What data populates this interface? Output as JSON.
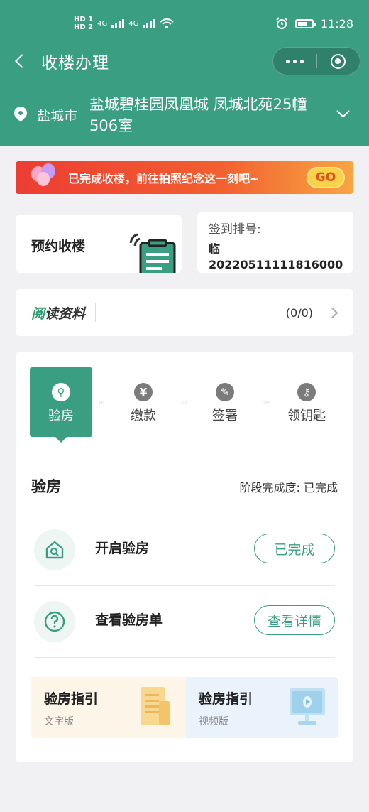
{
  "status_bar": {
    "hd1": "HD 1",
    "hd2": "HD 2",
    "network": "4G",
    "time": "11:28"
  },
  "nav": {
    "title": "收楼办理"
  },
  "location": {
    "city": "盐城市",
    "address": "盐城碧桂园凤凰城 凤城北苑25幢506室"
  },
  "banner": {
    "text": "已完成收楼，前往拍照纪念这一刻吧~",
    "button": "GO"
  },
  "appointment": {
    "label": "预约收楼"
  },
  "sign_in": {
    "label": "签到排号:",
    "value_line1": "临",
    "value_line2": "20220511111816000"
  },
  "reading": {
    "title_prefix": "阅",
    "title_rest": "读资料",
    "count": "(0/0)"
  },
  "steps": [
    {
      "label": "验房",
      "icon": "search-icon",
      "glyph": "⚲"
    },
    {
      "label": "缴款",
      "icon": "yuan-icon",
      "glyph": "¥"
    },
    {
      "label": "签署",
      "icon": "pen-icon",
      "glyph": "✎"
    },
    {
      "label": "领钥匙",
      "icon": "key-icon",
      "glyph": "⚷"
    }
  ],
  "stage": {
    "title": "验房",
    "progress": "阶段完成度:  已完成"
  },
  "tasks": [
    {
      "name": "开启验房",
      "button": "已完成",
      "icon": "house-search-icon"
    },
    {
      "name": "查看验房单",
      "button": "查看详情",
      "icon": "question-icon"
    }
  ],
  "guides": [
    {
      "title": "验房指引",
      "subtitle": "文字版",
      "icon": "document-icon"
    },
    {
      "title": "验房指引",
      "subtitle": "视频版",
      "icon": "monitor-icon"
    }
  ],
  "colors": {
    "primary": "#3a9e83",
    "banner_start": "#ec3d33",
    "banner_end": "#f7a543",
    "go_button": "#f8d24a"
  }
}
